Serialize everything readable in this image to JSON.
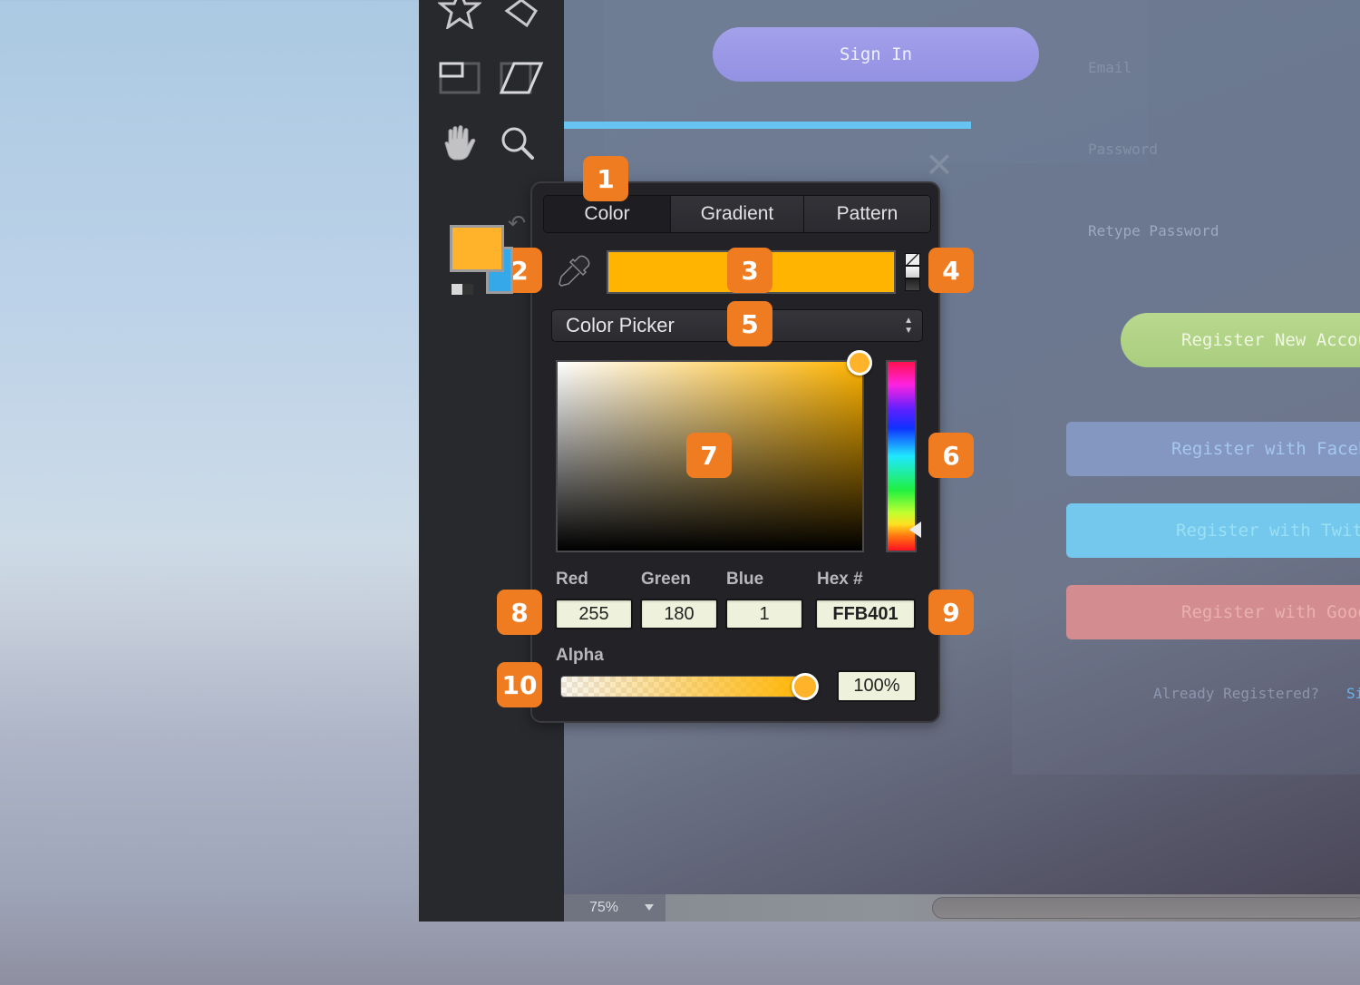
{
  "toolbar": {
    "tools": [
      {
        "name": "star-tool"
      },
      {
        "name": "diamond-tool"
      },
      {
        "name": "frame-tool"
      },
      {
        "name": "skew-tool"
      },
      {
        "name": "hand-tool"
      },
      {
        "name": "zoom-tool"
      }
    ],
    "fill_color": "#FFB32A",
    "stroke_color": "#35A8EA"
  },
  "canvas": {
    "sign_in_label": "Sign In",
    "email_label": "Email",
    "password_label": "Password",
    "retype_password_label": "Retype Password",
    "register_new_label": "Register New Account",
    "register_facebook_label": "Register with Facebook",
    "register_twitter_label": "Register with Twitter",
    "register_google_label": "Register with Google",
    "already_registered_label": "Already Registered?",
    "sign_in_link_label": "Sign In",
    "close_glyph": "✕"
  },
  "statusbar": {
    "zoom_level": "75%"
  },
  "color_popover": {
    "tabs": [
      {
        "label": "Color",
        "active": true
      },
      {
        "label": "Gradient",
        "active": false
      },
      {
        "label": "Pattern",
        "active": false
      }
    ],
    "current_color": "#FFB401",
    "mode_select": "Color Picker",
    "hue_value_percent": 88,
    "rgb_labels": {
      "red": "Red",
      "green": "Green",
      "blue": "Blue",
      "hex": "Hex #"
    },
    "rgb_values": {
      "red": "255",
      "green": "180",
      "blue": "1",
      "hex": "FFB401"
    },
    "alpha_label": "Alpha",
    "alpha_value": "100%",
    "alpha_fraction": 1.0
  },
  "annotations": [
    {
      "number": "1",
      "target": "color-tab"
    },
    {
      "number": "2",
      "target": "fill-stroke-swatches"
    },
    {
      "number": "3",
      "target": "current-color-bar"
    },
    {
      "number": "4",
      "target": "fill-presets"
    },
    {
      "number": "5",
      "target": "color-mode-select"
    },
    {
      "number": "6",
      "target": "hue-slider"
    },
    {
      "number": "7",
      "target": "saturation-brightness-area"
    },
    {
      "number": "8",
      "target": "rgb-fields"
    },
    {
      "number": "9",
      "target": "hex-field"
    },
    {
      "number": "10",
      "target": "alpha-slider"
    }
  ],
  "accent_colors": {
    "badge": "#F07C22",
    "sign_in_button": "#9A98E6",
    "register_new": "#B1D386",
    "facebook": "#8397C1",
    "twitter": "#74C8EE",
    "google": "#D38D90"
  }
}
